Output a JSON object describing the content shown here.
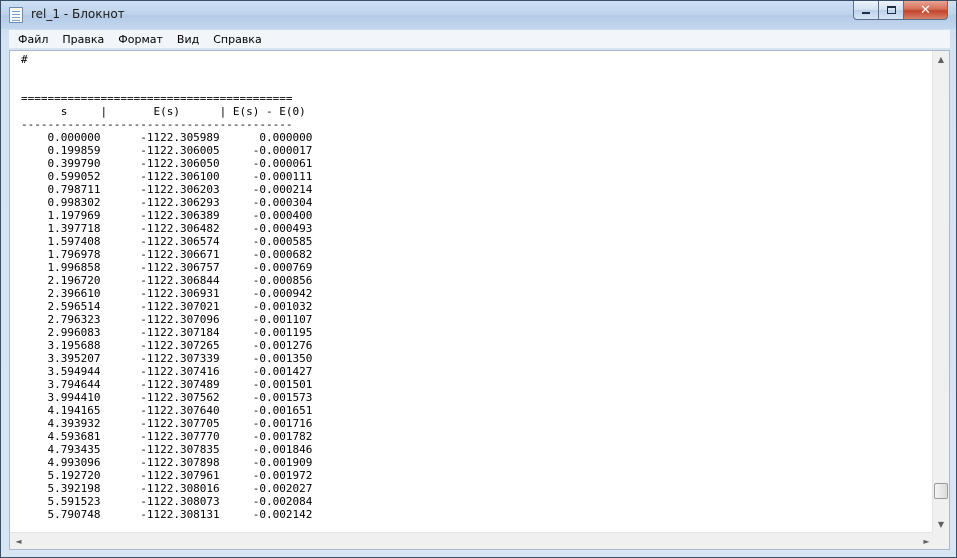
{
  "window": {
    "title": "rel_1 - Блокнот",
    "icon": "notepad-icon",
    "buttons": {
      "minimize": "minimize-icon",
      "maximize": "maximize-icon",
      "close": "✕"
    }
  },
  "menu": {
    "items": [
      "Файл",
      "Правка",
      "Формат",
      "Вид",
      "Справка"
    ]
  },
  "document": {
    "header_mark": "#",
    "separator_top": "=========================================",
    "column_header": "      s     |       E(s)      | E(s) - E(0)",
    "separator_mid": "-----------------------------------------",
    "columns": [
      "s",
      "E(s)",
      "E(s) - E(0)"
    ],
    "rows": [
      [
        "0.000000",
        "-1122.305989",
        "0.000000"
      ],
      [
        "0.199859",
        "-1122.306005",
        "-0.000017"
      ],
      [
        "0.399790",
        "-1122.306050",
        "-0.000061"
      ],
      [
        "0.599052",
        "-1122.306100",
        "-0.000111"
      ],
      [
        "0.798711",
        "-1122.306203",
        "-0.000214"
      ],
      [
        "0.998302",
        "-1122.306293",
        "-0.000304"
      ],
      [
        "1.197969",
        "-1122.306389",
        "-0.000400"
      ],
      [
        "1.397718",
        "-1122.306482",
        "-0.000493"
      ],
      [
        "1.597408",
        "-1122.306574",
        "-0.000585"
      ],
      [
        "1.796978",
        "-1122.306671",
        "-0.000682"
      ],
      [
        "1.996858",
        "-1122.306757",
        "-0.000769"
      ],
      [
        "2.196720",
        "-1122.306844",
        "-0.000856"
      ],
      [
        "2.396610",
        "-1122.306931",
        "-0.000942"
      ],
      [
        "2.596514",
        "-1122.307021",
        "-0.001032"
      ],
      [
        "2.796323",
        "-1122.307096",
        "-0.001107"
      ],
      [
        "2.996083",
        "-1122.307184",
        "-0.001195"
      ],
      [
        "3.195688",
        "-1122.307265",
        "-0.001276"
      ],
      [
        "3.395207",
        "-1122.307339",
        "-0.001350"
      ],
      [
        "3.594944",
        "-1122.307416",
        "-0.001427"
      ],
      [
        "3.794644",
        "-1122.307489",
        "-0.001501"
      ],
      [
        "3.994410",
        "-1122.307562",
        "-0.001573"
      ],
      [
        "4.194165",
        "-1122.307640",
        "-0.001651"
      ],
      [
        "4.393932",
        "-1122.307705",
        "-0.001716"
      ],
      [
        "4.593681",
        "-1122.307770",
        "-0.001782"
      ],
      [
        "4.793435",
        "-1122.307835",
        "-0.001846"
      ],
      [
        "4.993096",
        "-1122.307898",
        "-0.001909"
      ],
      [
        "5.192720",
        "-1122.307961",
        "-0.001972"
      ],
      [
        "5.392198",
        "-1122.308016",
        "-0.002027"
      ],
      [
        "5.591523",
        "-1122.308073",
        "-0.002084"
      ],
      [
        "5.790748",
        "-1122.308131",
        "-0.002142"
      ]
    ]
  },
  "scrollbars": {
    "vertical": {
      "position_fraction": 0.96
    },
    "up_arrow": "▲",
    "down_arrow": "▼",
    "left_arrow": "◄",
    "right_arrow": "►"
  },
  "colors": {
    "frame": "#c9dbef",
    "close_button": "#c3452c",
    "text": "#000000"
  }
}
